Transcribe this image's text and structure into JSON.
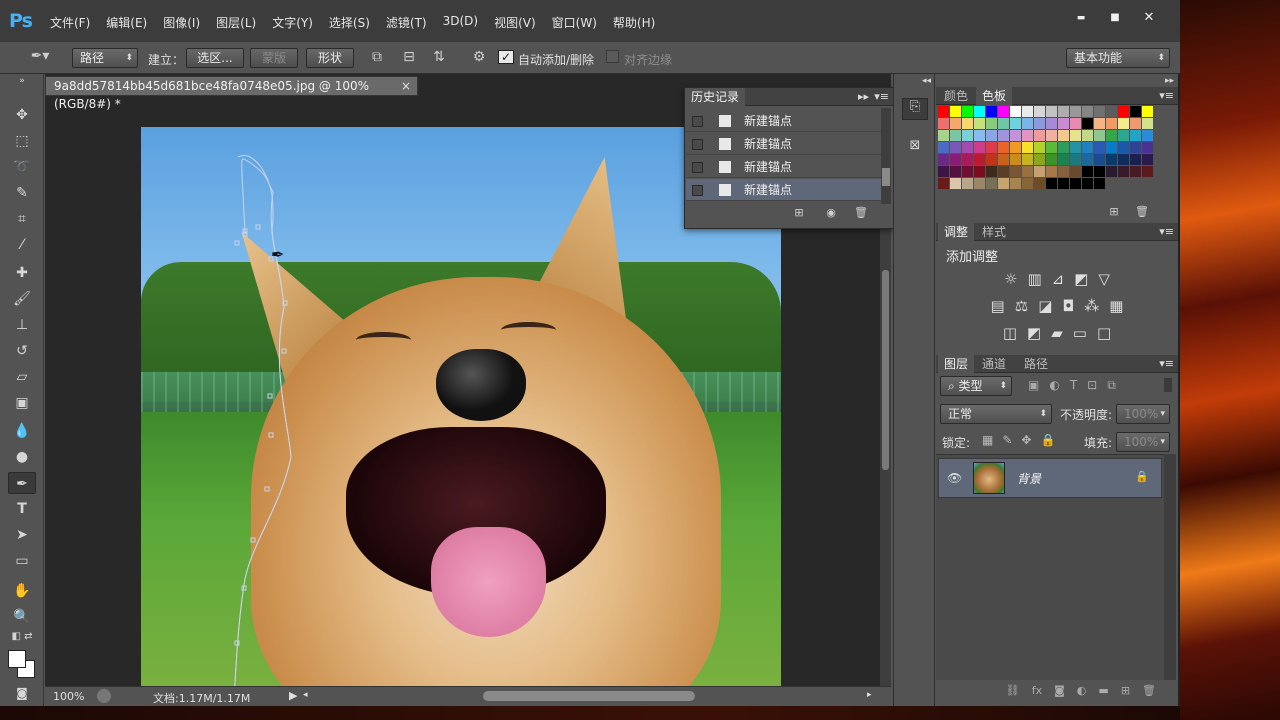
{
  "app": {
    "logo": "Ps"
  },
  "menu": [
    "文件(F)",
    "编辑(E)",
    "图像(I)",
    "图层(L)",
    "文字(Y)",
    "选择(S)",
    "滤镜(T)",
    "3D(D)",
    "视图(V)",
    "窗口(W)",
    "帮助(H)"
  ],
  "window_controls": {
    "minimize": "▬",
    "maximize": "■",
    "close": "✕"
  },
  "options": {
    "mode": "路径",
    "make_label": "建立：",
    "selection_btn": "选区...",
    "mask_btn": "蒙版",
    "shape_btn": "形状",
    "auto_add_delete": "自动添加/删除",
    "auto_add_delete_checked": true,
    "align_edges": "对齐边缘",
    "align_edges_checked": false,
    "workspace": "基本功能"
  },
  "document": {
    "tab_title": "9a8dd57814bb45d681bce48fa0748e05.jpg @ 100%(RGB/8#) *",
    "close": "×"
  },
  "status": {
    "zoom": "100%",
    "doc_info": "文档:1.17M/1.17M"
  },
  "history_panel": {
    "title": "历史记录",
    "items": [
      "新建锚点",
      "新建锚点",
      "新建锚点",
      "新建锚点"
    ],
    "selected_index": 3
  },
  "swatches_panel": {
    "tabs": [
      "颜色",
      "色板"
    ],
    "active_tab": "色板",
    "colors": [
      "#ff0000",
      "#ffff00",
      "#00ff00",
      "#00ffff",
      "#0000ff",
      "#ff00ff",
      "#ffffff",
      "#ebebeb",
      "#d6d6d6",
      "#c2c2c2",
      "#adadad",
      "#999999",
      "#858585",
      "#707070",
      "#5c5c5c",
      "#ff0000",
      "#000000",
      "#ffff00",
      "#f06e6e",
      "#f4a86a",
      "#f8d66e",
      "#c6e07a",
      "#86cc7a",
      "#6ec8a8",
      "#6ed2e0",
      "#7ab4e8",
      "#8a9ae0",
      "#a68ad8",
      "#cc8ad4",
      "#ea8ab4",
      "#000000",
      "#f6b482",
      "#f29a62",
      "#f6ea8e",
      "#ee9a6e",
      "#d2e28a",
      "#a6d48a",
      "#7ac6a2",
      "#7ad0d6",
      "#86bcf0",
      "#8aa6e6",
      "#9e94e0",
      "#c492d8",
      "#e294c2",
      "#f09a9a",
      "#f2b0a0",
      "#f6c88a",
      "#e8e28a",
      "#c2da86",
      "#8ec88e",
      "#33a84a",
      "#2aa890",
      "#22a4c8",
      "#2a8cd8",
      "#4a6cc8",
      "#7a58b8",
      "#a44ab0",
      "#d23a8c",
      "#e03a4a",
      "#e8642a",
      "#f09a22",
      "#f6e02a",
      "#b4d22e",
      "#5cba3a",
      "#2a9e5a",
      "#2294a4",
      "#2280c0",
      "#2a5ab4",
      "#0a7ac8",
      "#1a58a8",
      "#2e4296",
      "#4a3290",
      "#6a2888",
      "#8a1c78",
      "#aa1a5a",
      "#bc1a30",
      "#c2341a",
      "#c8621a",
      "#cc8c1a",
      "#c8b41a",
      "#8aa81a",
      "#3c9428",
      "#1a8450",
      "#1a7a80",
      "#1a6aa0",
      "#1a4a90",
      "#0a3a6a",
      "#102c5e",
      "#1a2050",
      "#2a1a4e",
      "#3e1446",
      "#561040",
      "#6e0e32",
      "#7a0c1e",
      "#3e2a1a",
      "#5a3e26",
      "#7a5634",
      "#9a7040",
      "#c8a070",
      "#a87848",
      "#88603a",
      "#6a4a2c",
      "#000000",
      "#000000",
      "#2a1a30",
      "#3a1a2a",
      "#4a1a24",
      "#5a1a1e",
      "#6a1a18",
      "#d8c8a8",
      "#b8a888",
      "#988868",
      "#787052",
      "#c8a46e",
      "#a8844e",
      "#886436",
      "#6e4c26",
      "#000000",
      "#000000",
      "#000000",
      "#000000",
      "#000000"
    ]
  },
  "adjustments_panel": {
    "tabs": [
      "调整",
      "样式"
    ],
    "active_tab": "调整",
    "title": "添加调整"
  },
  "layers_panel": {
    "tabs": [
      "图层",
      "通道",
      "路径"
    ],
    "active_tab": "图层",
    "filter_kind": "类型",
    "blend_mode": "正常",
    "opacity_label": "不透明度:",
    "opacity_value": "100%",
    "lock_label": "锁定:",
    "fill_label": "填充:",
    "fill_value": "100%",
    "layer_name": "背景"
  }
}
